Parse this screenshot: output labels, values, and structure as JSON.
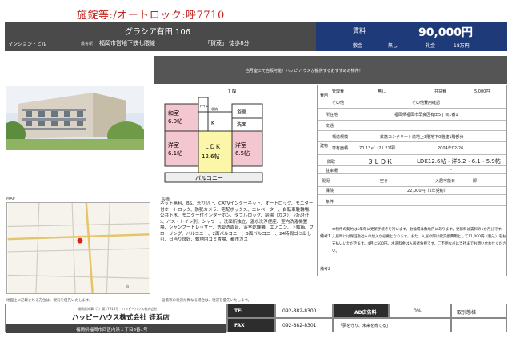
{
  "handwritten_note": "施錠等:/オートロック:呼7710",
  "header": {
    "building_name": "グラシア有田 106",
    "type_tag": "マンション・ビル",
    "line_label": "最寄駅",
    "line": "福岡市営地下鉄七隈線",
    "station_walk": "「賀茂」 徒歩8分",
    "rent_label": "賃料",
    "rent_value": "90,000円",
    "deposit_label": "敷金",
    "deposit_value": "無し",
    "key_money_label": "礼金",
    "key_money_value": "18万円"
  },
  "banner_text": "当号室にて自販可能！ハッピ ハウスが提供するおすすめの物件！",
  "floorplan": {
    "room_washitsu": "和室",
    "room_washitsu_size": "6.0帖",
    "room_western_left": "洋室",
    "room_western_left_size": "6.1帖",
    "room_ldk": "ＬＤＫ",
    "room_ldk_size": "12.6帖",
    "room_western_right": "洋室",
    "room_western_right_size": "6.5帖",
    "balcony": "バルコニー",
    "kitchen": "K",
    "bath": "浴室",
    "washroom": "洗面",
    "toilet": "トイレ",
    "storage": "収納"
  },
  "info": {
    "group_fee": "費用",
    "mgmt_label": "管理費",
    "mgmt_value": "無し",
    "common_label": "共益費",
    "common_value": "5,000円",
    "other_label": "その他",
    "other_value": "その他費用確認",
    "addr_label": "所在地",
    "addr_value": "福岡県福岡市早良区有田5丁目1番1",
    "transport_label": "交通",
    "group_bldg": "建物",
    "struct_label": "構造規模",
    "struct_value": "鉄筋コンクリート造地上3階地下0階建1階部分",
    "area_label": "専有面積",
    "area_value": "70.13㎡（21.21坪）",
    "built_label": "築年",
    "built_value": "2004年02-26",
    "layout_label": "間取",
    "layout_value": "３ＬＤＫ",
    "layout_detail": "LDK12.6帖・洋6.2・6.1・5.9帖",
    "parking_label": "駐車場",
    "parking_value": "-",
    "status_label": "現況",
    "status_value": "空き",
    "move_in_label": "入居可能日",
    "move_in_value": "即",
    "insurance_label": "保険",
    "insurance_value": "22,000円（2年契約）",
    "features_label": "条件",
    "remarks_label": "備考1",
    "remarks_text": "本物件の契約は1年毎に更新手続きを行います。駐輪場は敷地内にあります。更新料は賃料の1か月分です。入居時には保証会社への加入が必要となります。また、入居の際は鍵交換費用として11,000円（税込）をお支払いいただきます。4月に500円、水道料金は入居者負担です。ご不明な点は当社までお問い合わせください。",
    "remarks2_label": "備考2"
  },
  "map_label": "MAP",
  "facilities_label": "設備",
  "facilities_text": "ネット無料、BS、光ﾌｧｲﾊﾞｰ、CATVインターネット、オートロック、モニター付オートロック、防犯カメラ、宅配ボックス、エレベーター、自転車駐輪場、公共下水、モニター付インターホン、ダブルロック、給湯（ガス）、ｼｽﾃﾑｷｯﾁﾝ、バス・トイレ別、シャワー、洗面所独立、温水洗浄便座、室内洗濯機置場、シャンプードレッサー、洗髪洗面台、浴室乾燥機、エアコン、下駄箱、フローリング、バルコニー、2面バルコニー、3面バルコニー、24時間ゴミ出し可、日当り良好、敷地内ゴミ置場、都市ガス",
  "note_left": "地図上に記載される方位は、現況を優先いたします。",
  "note_right": "設備等の状況が異なる場合は、現況を優先いたします。",
  "footer": {
    "license": "福岡県知事（1）第17914号　ハッピーハウス株式会社",
    "company": "ハッピーハウス株式会社 姪浜店",
    "address": "福岡県福岡市西区内浜１丁目8番1号",
    "tel_label": "TEL",
    "tel": "092-882-8300",
    "ad_label": "AD広告料",
    "ad_value": "0%",
    "deal_label": "取引態様",
    "fax_label": "FAX",
    "fax": "092-882-8301",
    "catch": "「夢を守り、未来を育てる」"
  }
}
